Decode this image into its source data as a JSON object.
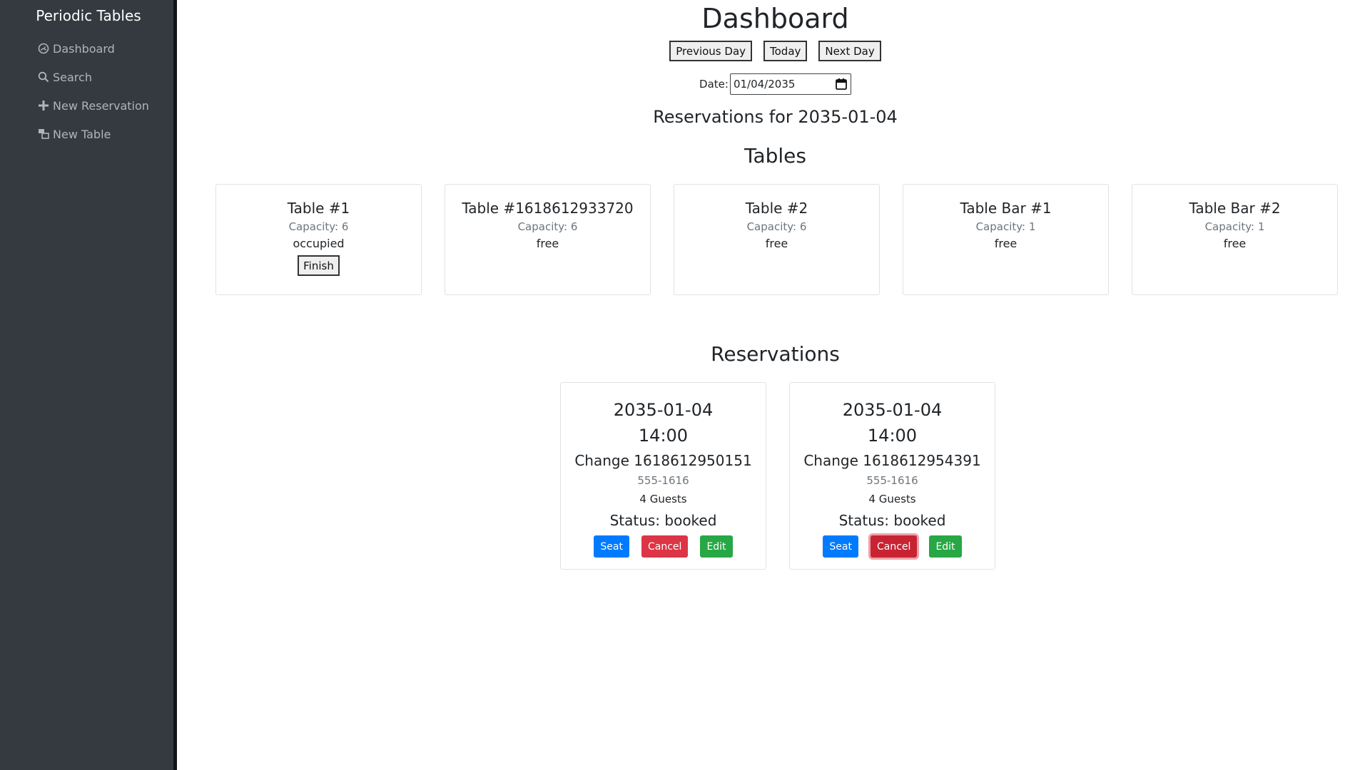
{
  "sidebar": {
    "brand": "Periodic Tables",
    "items": [
      {
        "label": "Dashboard",
        "icon": "dashboard-icon"
      },
      {
        "label": "Search",
        "icon": "search-icon"
      },
      {
        "label": "New Reservation",
        "icon": "plus-icon"
      },
      {
        "label": "New Table",
        "icon": "new-table-icon"
      }
    ]
  },
  "header": {
    "title": "Dashboard",
    "previous_day": "Previous Day",
    "today": "Today",
    "next_day": "Next Day",
    "date_label": "Date:",
    "date_value": "01/04/2035",
    "reservations_for": "Reservations for 2035-01-04"
  },
  "tables_section": {
    "heading": "Tables",
    "tables": [
      {
        "name": "Table #1",
        "capacity": "Capacity: 6",
        "status": "occupied",
        "action": "Finish"
      },
      {
        "name": "Table #1618612933720",
        "capacity": "Capacity: 6",
        "status": "free"
      },
      {
        "name": "Table #2",
        "capacity": "Capacity: 6",
        "status": "free"
      },
      {
        "name": "Table Bar #1",
        "capacity": "Capacity: 1",
        "status": "free"
      },
      {
        "name": "Table Bar #2",
        "capacity": "Capacity: 1",
        "status": "free"
      }
    ]
  },
  "reservations_section": {
    "heading": "Reservations",
    "reservations": [
      {
        "date": "2035-01-04",
        "time": "14:00",
        "name": "Change 1618612950151",
        "phone": "555-1616",
        "guests": "4 Guests",
        "status": "Status: booked",
        "seat": "Seat",
        "cancel": "Cancel",
        "edit": "Edit"
      },
      {
        "date": "2035-01-04",
        "time": "14:00",
        "name": "Change 1618612954391",
        "phone": "555-1616",
        "guests": "4 Guests",
        "status": "Status: booked",
        "seat": "Seat",
        "cancel": "Cancel",
        "edit": "Edit"
      }
    ]
  },
  "colors": {
    "sidebar_bg": "#343a40",
    "primary": "#007bff",
    "danger": "#dc3545",
    "success": "#28a745",
    "muted": "#6c757d"
  }
}
